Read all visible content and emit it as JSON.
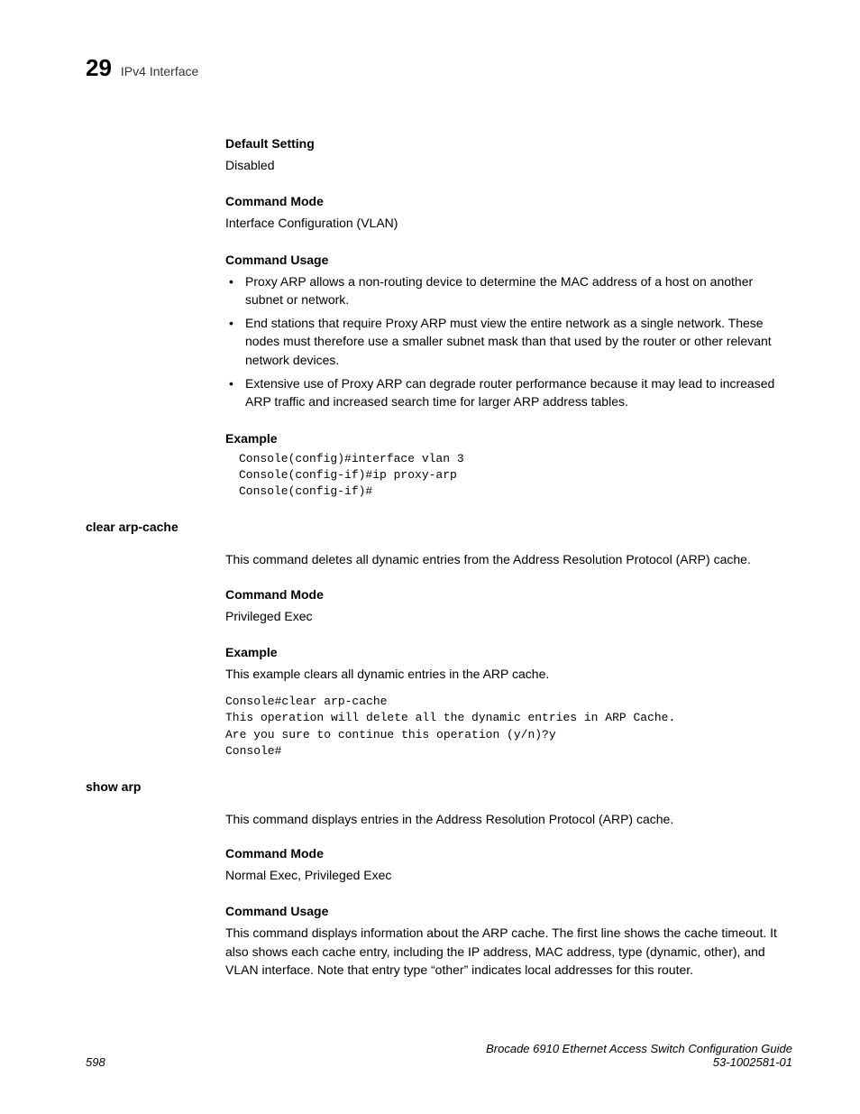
{
  "header": {
    "chapter_number": "29",
    "chapter_title": "IPv4 Interface"
  },
  "sections": {
    "default_setting": {
      "heading": "Default Setting",
      "text": "Disabled"
    },
    "command_mode_1": {
      "heading": "Command Mode",
      "text": "Interface Configuration (VLAN)"
    },
    "command_usage_1": {
      "heading": "Command Usage",
      "bullets": [
        "Proxy ARP allows a non-routing device to determine the MAC address of a host on another subnet or network.",
        "End stations that require Proxy ARP must view the entire network as a single network. These nodes must therefore use a smaller subnet mask than that used by the router or other relevant network devices.",
        "Extensive use of Proxy ARP can degrade router performance because it may lead to increased ARP traffic and increased search time for larger ARP address tables."
      ]
    },
    "example_1": {
      "heading": "Example",
      "code": "Console(config)#interface vlan 3\nConsole(config-if)#ip proxy-arp\nConsole(config-if)#"
    },
    "clear_arp_cache": {
      "command": "clear arp-cache",
      "description": "This command deletes all dynamic entries from the Address Resolution Protocol (ARP) cache.",
      "command_mode_heading": "Command Mode",
      "command_mode_text": "Privileged Exec",
      "example_heading": "Example",
      "example_text": "This example clears all dynamic entries in the ARP cache.",
      "code": "Console#clear arp-cache\nThis operation will delete all the dynamic entries in ARP Cache.\nAre you sure to continue this operation (y/n)?y\nConsole#"
    },
    "show_arp": {
      "command": "show arp",
      "description": "This command displays entries in the Address Resolution Protocol (ARP) cache.",
      "command_mode_heading": "Command Mode",
      "command_mode_text": "Normal Exec, Privileged Exec",
      "command_usage_heading": "Command Usage",
      "command_usage_text": "This command displays information about the ARP cache. The first line shows the cache timeout. It also shows each cache entry, including the IP address, MAC address, type (dynamic, other), and VLAN interface. Note that entry type “other” indicates local addresses for this router."
    }
  },
  "footer": {
    "page_number": "598",
    "doc_title": "Brocade 6910 Ethernet Access Switch Configuration Guide",
    "doc_number": "53-1002581-01"
  }
}
